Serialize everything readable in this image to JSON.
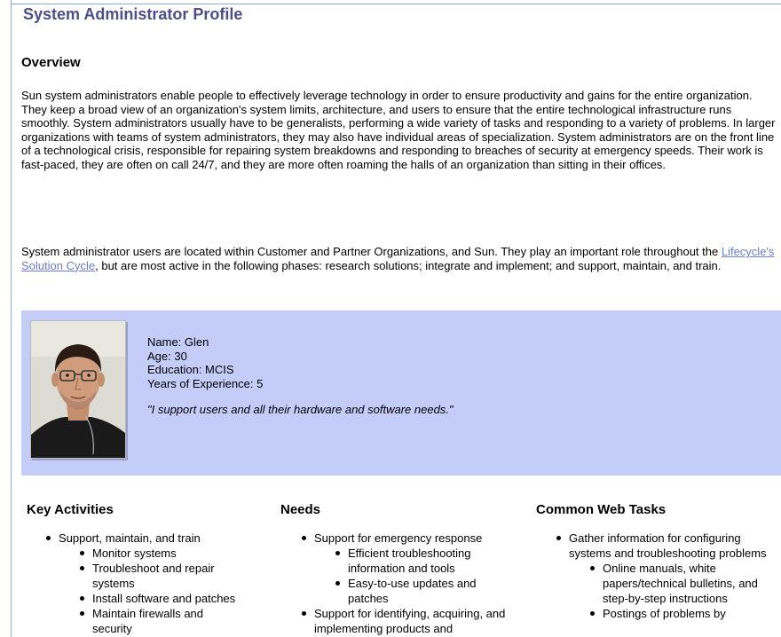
{
  "page_title": "System Administrator Profile",
  "overview": {
    "heading": "Overview",
    "p1": "Sun system administrators enable people to effectively leverage technology in order to ensure productivity and gains for the entire organization. They keep a broad view of an organization's system limits, architecture, and users to ensure that the entire technological infrastructure runs smoothly. System administrators usually have to be generalists, performing a wide variety of tasks and responding to a variety of problems. In larger organizations with teams of system administrators, they may also have individual areas of specialization. System administrators are on the front line of a technological crisis, responsible for repairing system breakdowns and responding to breaches of security at emergency speeds. Their work is fast-paced, they are often on call 24/7, and they are more often roaming the halls of an organization than sitting in their offices.",
    "p2_before": "System administrator users are located within Customer and Partner Organizations, and Sun. They play an important role throughout the ",
    "p2_link": "Lifecycle's Solution Cycle",
    "p2_after": ", but are most active in the following phases: research solutions; integrate and implement; and support, maintain, and train."
  },
  "persona": {
    "name": "Name: Glen",
    "age": "Age: 30",
    "education": "Education: MCIS",
    "experience": "Years of Experience: 5",
    "quote": "\"I support users and all their hardware and software needs.\""
  },
  "columns": {
    "key_activities": {
      "heading": "Key Activities",
      "item1": "Support, maintain, and train",
      "sub1": "Monitor systems",
      "sub2": "Troubleshoot and repair systems",
      "sub3": "Install software and patches",
      "sub4": "Maintain firewalls and security"
    },
    "needs": {
      "heading": "Needs",
      "item1": "Support for emergency response",
      "sub1": "Efficient troubleshooting information and tools",
      "sub2": "Easy-to-use updates and patches",
      "item2": "Support for identifying, acquiring, and implementing products and"
    },
    "web_tasks": {
      "heading": "Common Web Tasks",
      "item1": "Gather information for configuring systems and troubleshooting problems",
      "sub1": "Online manuals, white papers/technical bulletins, and step-by-step instructions",
      "sub2": "Postings of problems by"
    }
  }
}
